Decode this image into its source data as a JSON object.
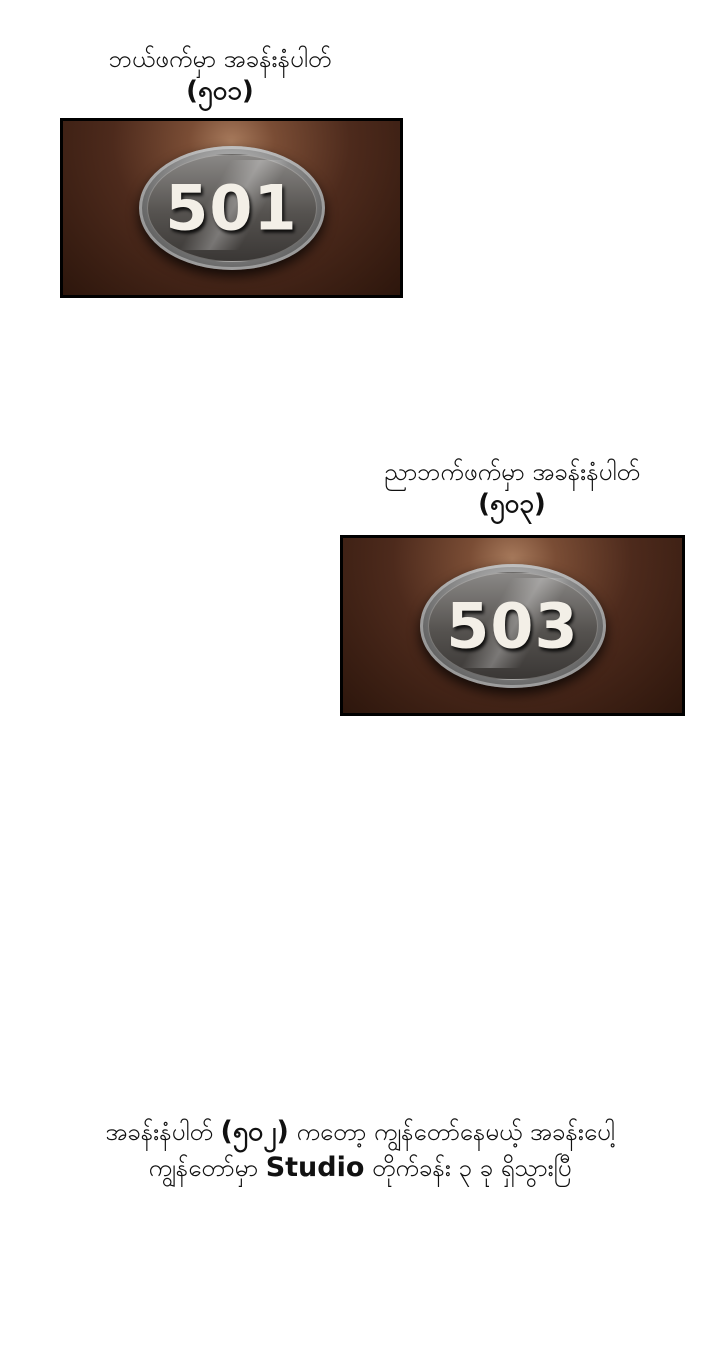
{
  "panel1": {
    "caption_line1": "ဘယ်ဖက်မှာ အခန်းနံပါတ်",
    "caption_line2": "(၅၀၁)",
    "plaque_number": "501"
  },
  "panel2": {
    "caption_line1": "ညာဘက်ဖက်မှာ အခန်းနံပါတ်",
    "caption_line2": "(၅၀၃)",
    "plaque_number": "503"
  },
  "bottom_caption": {
    "line1_part1": "အခန်းနံပါတ် ",
    "line1_bold": "(၅၀၂)",
    "line1_part2": " ကတော့ ကျွန်တော်နေမယ့် အခန်းပေါ့",
    "line2_part1": "ကျွန်တော်မှာ ",
    "line2_bold": "Studio",
    "line2_part2": " တိုက်ခန်း ၃ ခု ရှိသွားပြီ"
  },
  "colors": {
    "panel_background": "#4d2a1c",
    "plaque": "#55524f",
    "plaque_text": "#f3efe7"
  }
}
